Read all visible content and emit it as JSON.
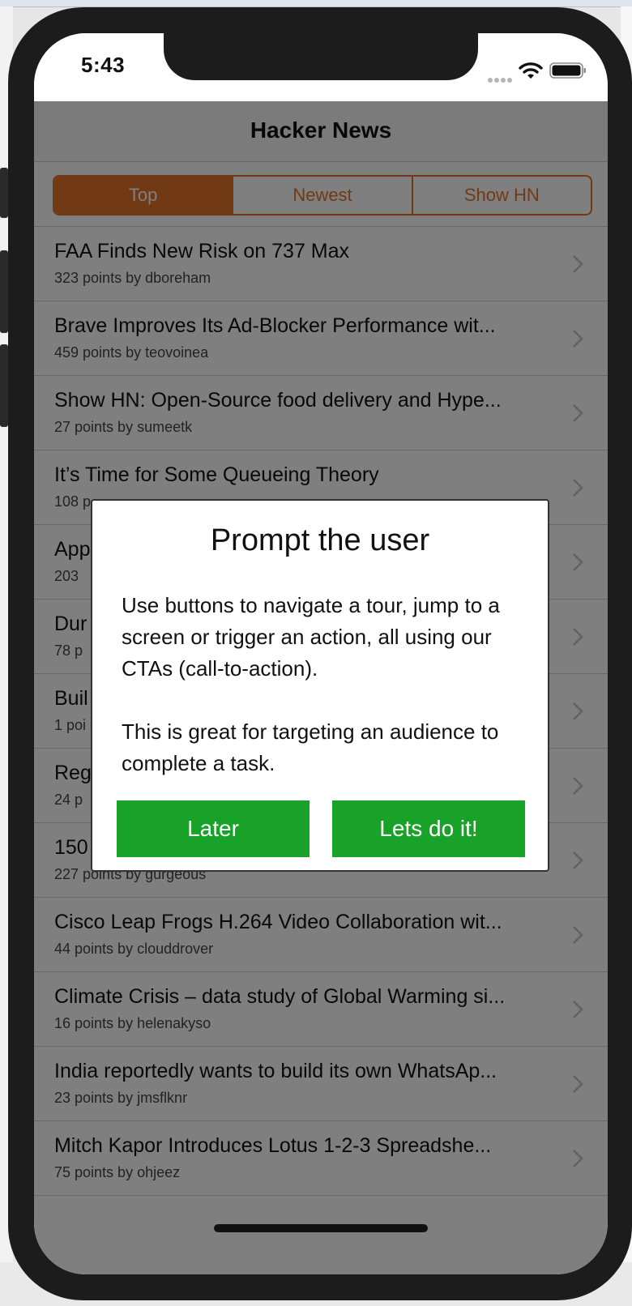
{
  "status": {
    "time": "5:43"
  },
  "nav": {
    "title": "Hacker News"
  },
  "segments": [
    {
      "label": "Top",
      "active": true
    },
    {
      "label": "Newest",
      "active": false
    },
    {
      "label": "Show HN",
      "active": false
    }
  ],
  "stories": [
    {
      "title": "FAA Finds New Risk on 737 Max",
      "meta": "323 points by dboreham"
    },
    {
      "title": "Brave Improves Its Ad-Blocker Performance wit...",
      "meta": "459 points by teovoinea"
    },
    {
      "title": "Show HN: Open-Source food delivery and Hype...",
      "meta": "27 points by sumeetk"
    },
    {
      "title": "It’s Time for Some Queueing Theory",
      "meta": "108 p"
    },
    {
      "title": "App",
      "meta": "203"
    },
    {
      "title": "Dur",
      "meta": "78 p"
    },
    {
      "title": "Buil",
      "meta": "1 poi"
    },
    {
      "title": "Reg",
      "meta": "24 p"
    },
    {
      "title": "150",
      "meta": "227 points by gurgeous"
    },
    {
      "title": "Cisco Leap Frogs H.264 Video Collaboration wit...",
      "meta": "44 points by clouddrover"
    },
    {
      "title": "Climate Crisis – data study of Global Warming si...",
      "meta": "16 points by helenakyso"
    },
    {
      "title": "India reportedly wants to build its own WhatsAp...",
      "meta": "23 points by jmsflknr"
    },
    {
      "title": "Mitch Kapor Introduces Lotus 1-2-3 Spreadshe...",
      "meta": "75 points by ohjeez"
    }
  ],
  "modal": {
    "title": "Prompt the user",
    "body": "Use buttons to navigate a tour, jump to a screen or trigger an action, all using our CTAs (call-to-action).\n\nThis is great for targeting an audience to complete a task.",
    "later_label": "Later",
    "go_label": "Lets do it!"
  },
  "colors": {
    "accent": "#e5722a",
    "cta": "#18a228"
  },
  "icons": {
    "row_chevron": "chevron-right-icon",
    "wifi": "wifi-icon",
    "battery": "battery-icon",
    "signal": "signal-icon"
  }
}
